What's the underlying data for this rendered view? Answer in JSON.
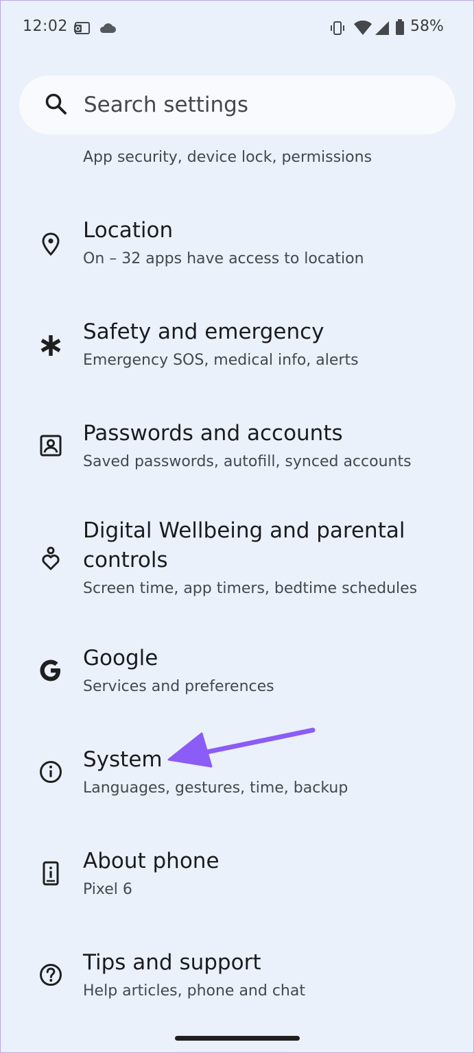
{
  "status_bar": {
    "time": "12:02",
    "battery": "58%",
    "icons": [
      "outlook-icon",
      "cloud-icon",
      "vibrate-icon",
      "wifi-icon",
      "cell-signal-icon",
      "battery-icon"
    ]
  },
  "search": {
    "placeholder": "Search settings",
    "icon": "search-icon"
  },
  "partial_item": {
    "subtitle": "App security, device lock, permissions"
  },
  "items": [
    {
      "title": "Location",
      "subtitle": "On – 32 apps have access to location",
      "icon": "location-pin-icon"
    },
    {
      "title": "Safety and emergency",
      "subtitle": "Emergency SOS, medical info, alerts",
      "icon": "asterisk-icon"
    },
    {
      "title": "Passwords and accounts",
      "subtitle": "Saved passwords, autofill, synced accounts",
      "icon": "account-box-icon"
    },
    {
      "title": "Digital Wellbeing and parental",
      "title_line2": "controls",
      "subtitle": "Screen time, app timers, bedtime schedules",
      "icon": "wellbeing-icon"
    },
    {
      "title": "Google",
      "subtitle": "Services and preferences",
      "icon": "google-icon"
    },
    {
      "title": "System",
      "subtitle": "Languages, gestures, time, backup",
      "icon": "info-icon"
    },
    {
      "title": "About phone",
      "subtitle": "Pixel 6",
      "icon": "phone-info-icon"
    },
    {
      "title": "Tips and support",
      "subtitle": "Help articles, phone and chat",
      "icon": "help-icon"
    }
  ],
  "colors": {
    "background": "#eaf1fb",
    "search_background": "#f8fafd",
    "annotation_arrow": "#8b5cf6"
  }
}
